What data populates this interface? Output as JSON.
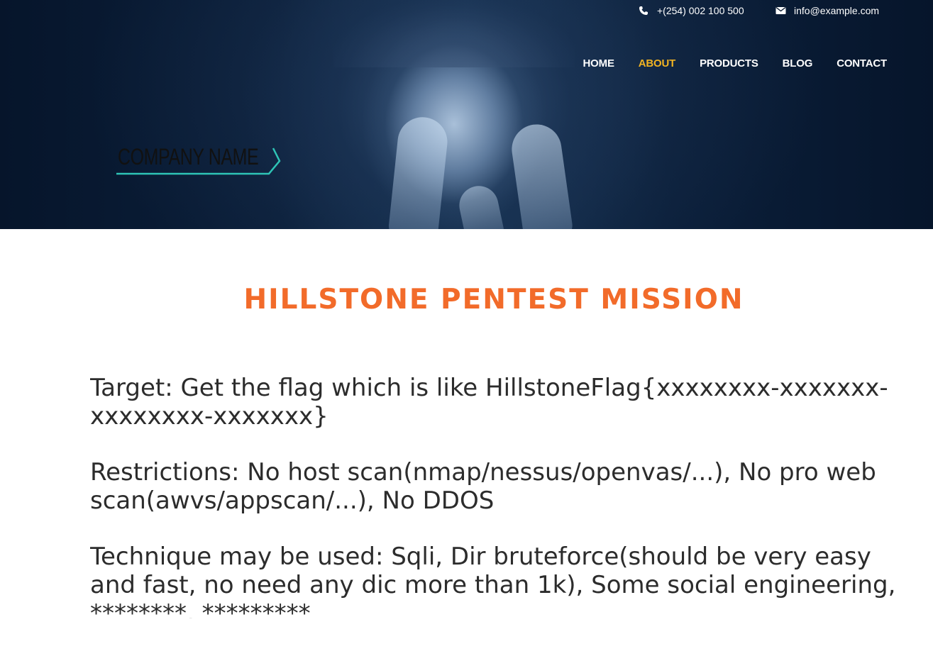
{
  "topbar": {
    "phone": "+(254) 002 100 500",
    "email": "info@example.com",
    "phone_icon": "phone-icon",
    "email_icon": "envelope-icon"
  },
  "nav": {
    "items": [
      "HOME",
      "ABOUT",
      "PRODUCTS",
      "BLOG",
      "CONTACT"
    ],
    "active": "ABOUT"
  },
  "logo": {
    "text": "COMPANY NAME"
  },
  "main": {
    "title": "HILLSTONE PENTEST MISSION",
    "paragraphs": [
      "Target: Get the flag which is like HillstoneFlag{xxxxxxxx-xxxxxxx-xxxxxxxx-xxxxxxx}",
      "Restrictions: No host scan(nmap/nessus/openvas/...), No pro web scan(awvs/appscan/...), No DDOS",
      "Technique may be used: Sqli, Dir bruteforce(should be very easy and fast, no need any dic more than 1k), Some social engineering, ********, *********"
    ]
  },
  "colors": {
    "title": "#f26b2a",
    "nav_active": "#f0b323",
    "logo_accent": "#2ec4b6",
    "hero_dark": "#0a1a30"
  }
}
